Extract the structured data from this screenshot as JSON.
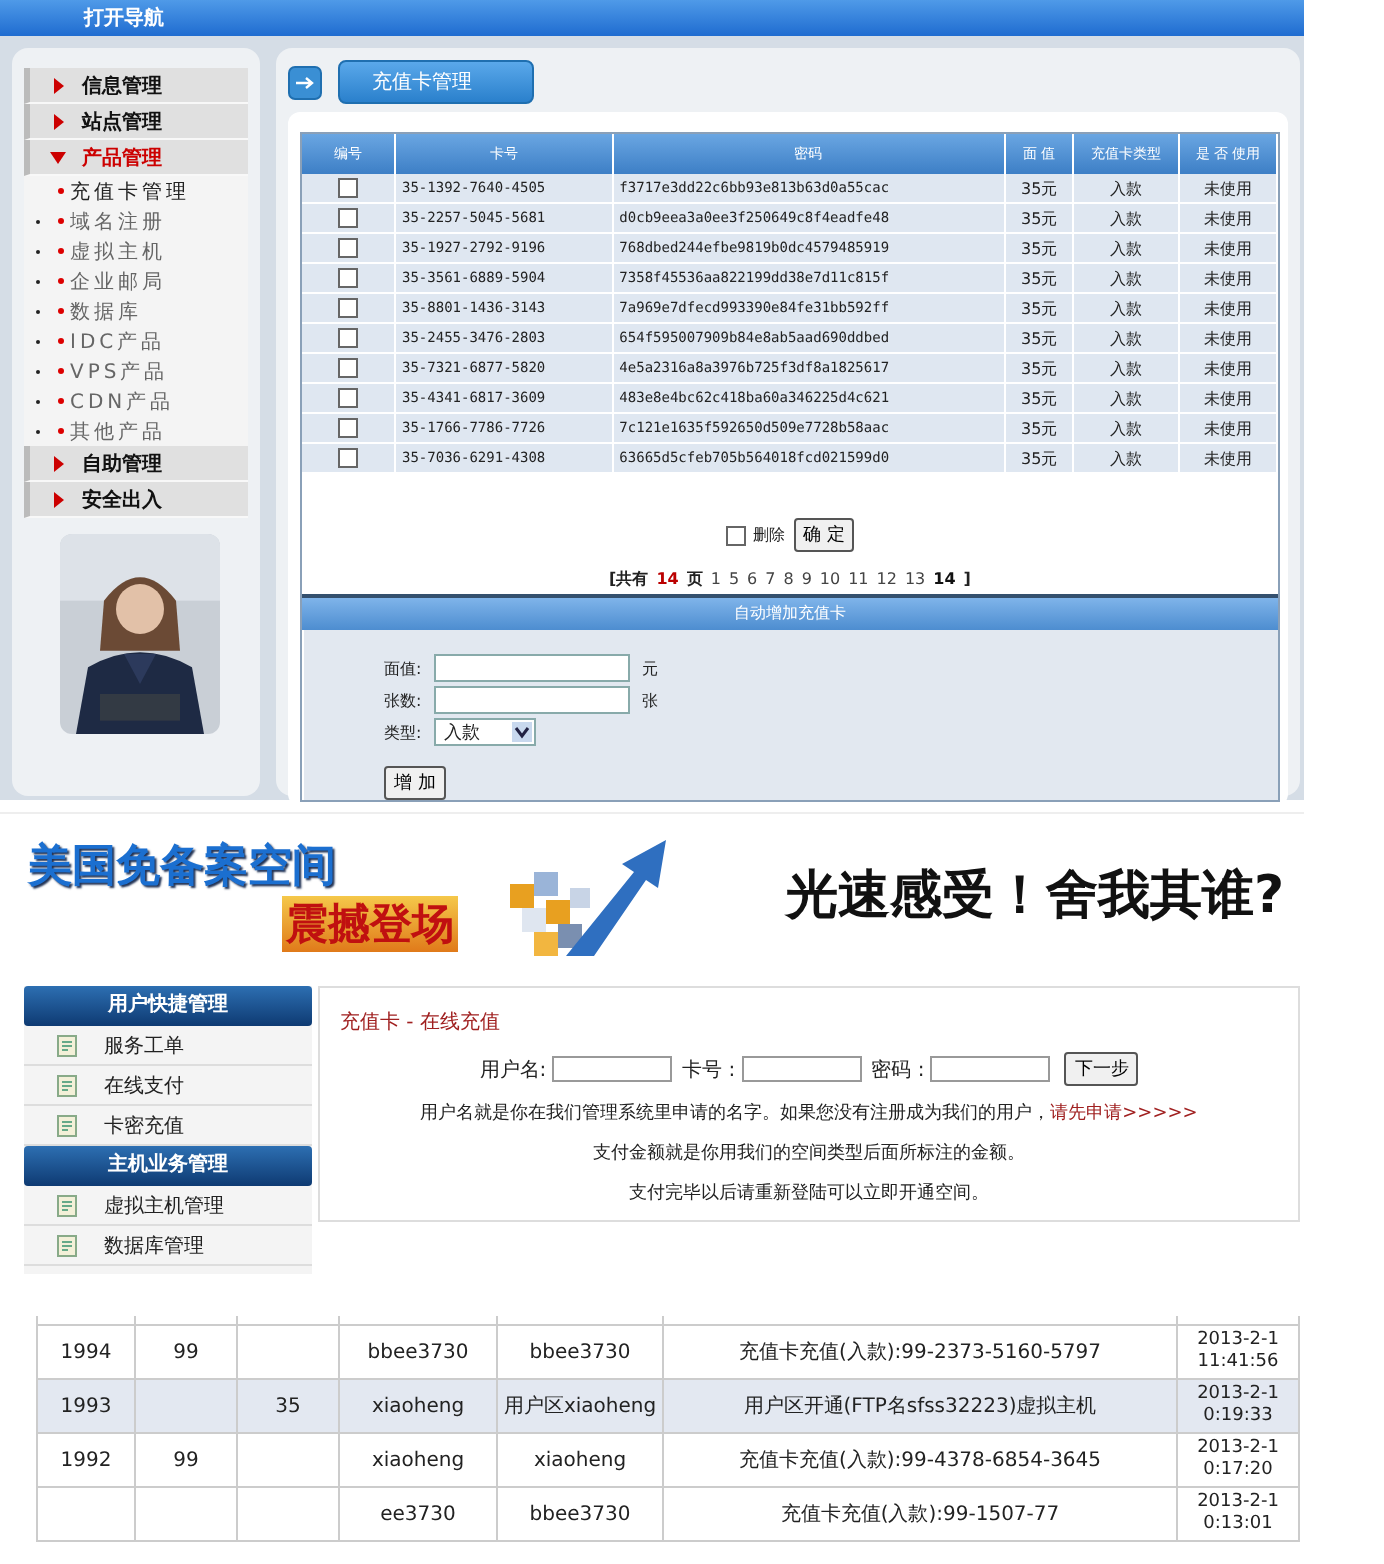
{
  "admin": {
    "topbar": {
      "title": "打开导航"
    },
    "sidebar": {
      "items": [
        {
          "label": "信息管理",
          "expanded": false
        },
        {
          "label": "站点管理",
          "expanded": false
        },
        {
          "label": "产品管理",
          "expanded": true,
          "children": [
            {
              "label": "充值卡管理",
              "selected": true
            },
            {
              "label": "域名注册",
              "selected": false
            },
            {
              "label": "虚拟主机",
              "selected": false
            },
            {
              "label": "企业邮局",
              "selected": false
            },
            {
              "label": "数据库",
              "selected": false
            },
            {
              "label": "IDC产品",
              "selected": false
            },
            {
              "label": "VPS产品",
              "selected": false
            },
            {
              "label": "CDN产品",
              "selected": false
            },
            {
              "label": "其他产品",
              "selected": false
            }
          ]
        },
        {
          "label": "自助管理",
          "expanded": false
        },
        {
          "label": "安全出入",
          "expanded": false
        }
      ]
    },
    "tab": "充值卡管理",
    "table": {
      "columns": [
        "编号",
        "卡号",
        "密码",
        "面 值",
        "充值卡类型",
        "是 否 使用"
      ],
      "rows": [
        {
          "checked": false,
          "card": "35-1392-7640-4505",
          "password": "f3717e3dd22c6bb93e813b63d0a55cac",
          "value": "35元",
          "type": "入款",
          "used": "未使用"
        },
        {
          "checked": false,
          "card": "35-2257-5045-5681",
          "password": "d0cb9eea3a0ee3f250649c8f4eadfe48",
          "value": "35元",
          "type": "入款",
          "used": "未使用"
        },
        {
          "checked": false,
          "card": "35-1927-2792-9196",
          "password": "768dbed244efbe9819b0dc4579485919",
          "value": "35元",
          "type": "入款",
          "used": "未使用"
        },
        {
          "checked": false,
          "card": "35-3561-6889-5904",
          "password": "7358f45536aa822199dd38e7d11c815f",
          "value": "35元",
          "type": "入款",
          "used": "未使用"
        },
        {
          "checked": false,
          "card": "35-8801-1436-3143",
          "password": "7a969e7dfecd993390e84fe31bb592ff",
          "value": "35元",
          "type": "入款",
          "used": "未使用"
        },
        {
          "checked": false,
          "card": "35-2455-3476-2803",
          "password": "654f595007909b84e8ab5aad690ddbed",
          "value": "35元",
          "type": "入款",
          "used": "未使用"
        },
        {
          "checked": false,
          "card": "35-7321-6877-5820",
          "password": "4e5a2316a8a3976b725f3df8a1825617",
          "value": "35元",
          "type": "入款",
          "used": "未使用"
        },
        {
          "checked": false,
          "card": "35-4341-6817-3609",
          "password": "483e8e4bc62c418ba60a346225d4c621",
          "value": "35元",
          "type": "入款",
          "used": "未使用"
        },
        {
          "checked": false,
          "card": "35-1766-7786-7726",
          "password": "7c121e1635f592650d509e7728b58aac",
          "value": "35元",
          "type": "入款",
          "used": "未使用"
        },
        {
          "checked": false,
          "card": "35-7036-6291-4308",
          "password": "63665d5cfeb705b564018fcd021599d0",
          "value": "35元",
          "type": "入款",
          "used": "未使用"
        }
      ]
    },
    "delete": {
      "label": "删除",
      "checked": false
    },
    "confirm_button": "确 定",
    "pagination": {
      "prefix": "[共有",
      "total": "14",
      "unit": "页",
      "pages": [
        {
          "label": "1",
          "selected": false
        },
        {
          "label": "5",
          "selected": false
        },
        {
          "label": "6",
          "selected": false
        },
        {
          "label": "7",
          "selected": false
        },
        {
          "label": "8",
          "selected": false
        },
        {
          "label": "9",
          "selected": false
        },
        {
          "label": "10",
          "selected": false
        },
        {
          "label": "11",
          "selected": false
        },
        {
          "label": "12",
          "selected": false
        },
        {
          "label": "13",
          "selected": false
        },
        {
          "label": "14",
          "selected": true
        }
      ],
      "suffix": "]"
    },
    "auto_add": {
      "title": "自动增加充值卡",
      "fields": [
        {
          "label": "面值:",
          "unit": "元"
        },
        {
          "label": "张数:",
          "unit": "张"
        }
      ],
      "type": {
        "label": "类型:",
        "value": "入款"
      },
      "button": "增 加"
    }
  },
  "host_panel": {
    "banner": {
      "slogan": "美国免备案空间",
      "badge": "震撼登场",
      "tagline": "光速感受！舍我其谁?"
    },
    "sidebar": [
      {
        "kind": "header",
        "label": "用户快捷管理"
      },
      {
        "kind": "item",
        "label": "服务工单"
      },
      {
        "kind": "item",
        "label": "在线支付"
      },
      {
        "kind": "item",
        "label": "卡密充值"
      },
      {
        "kind": "header",
        "label": "主机业务管理"
      },
      {
        "kind": "item",
        "label": "虚拟主机管理"
      },
      {
        "kind": "item",
        "label": "数据库管理"
      }
    ],
    "breadcrumb": "充值卡 - 在线充值",
    "fields": [
      {
        "label": "用户名:"
      },
      {
        "label": "卡号 :"
      },
      {
        "label": "密码 :"
      }
    ],
    "next_button": "下一步",
    "notes": [
      {
        "text": "用户名就是你在我们管理系统里申请的名字。如果您没有注册成为我们的用户，",
        "link": "请先申请>>>>>"
      },
      {
        "text": "支付金额就是你用我们的空间类型后面所标注的金额。"
      },
      {
        "text": "支付完毕以后请重新登陆可以立即开通空间。"
      }
    ]
  },
  "log_table": {
    "rows": [
      {
        "selected": false,
        "cells": [
          "1994",
          "99",
          "",
          "bbee3730",
          "bbee3730",
          "充值卡充值(入款):99-2373-5160-5797"
        ],
        "date": "2013-2-1",
        "time": "11:41:56"
      },
      {
        "selected": true,
        "cells": [
          "1993",
          "",
          "35",
          "xiaoheng",
          "用户区xiaoheng",
          "用户区开通(FTP名sfss32223)虚拟主机"
        ],
        "date": "2013-2-1",
        "time": "0:19:33"
      },
      {
        "selected": false,
        "cells": [
          "1992",
          "99",
          "",
          "xiaoheng",
          "xiaoheng",
          "充值卡充值(入款):99-4378-6854-3645"
        ],
        "date": "2013-2-1",
        "time": "0:17:20"
      },
      {
        "selected": false,
        "cells": [
          "",
          "",
          "",
          "ee3730",
          "bbee3730",
          "充值卡充值(入款):99-1507-77"
        ],
        "date": "2013-2-1",
        "time": "0:13:01"
      }
    ]
  }
}
